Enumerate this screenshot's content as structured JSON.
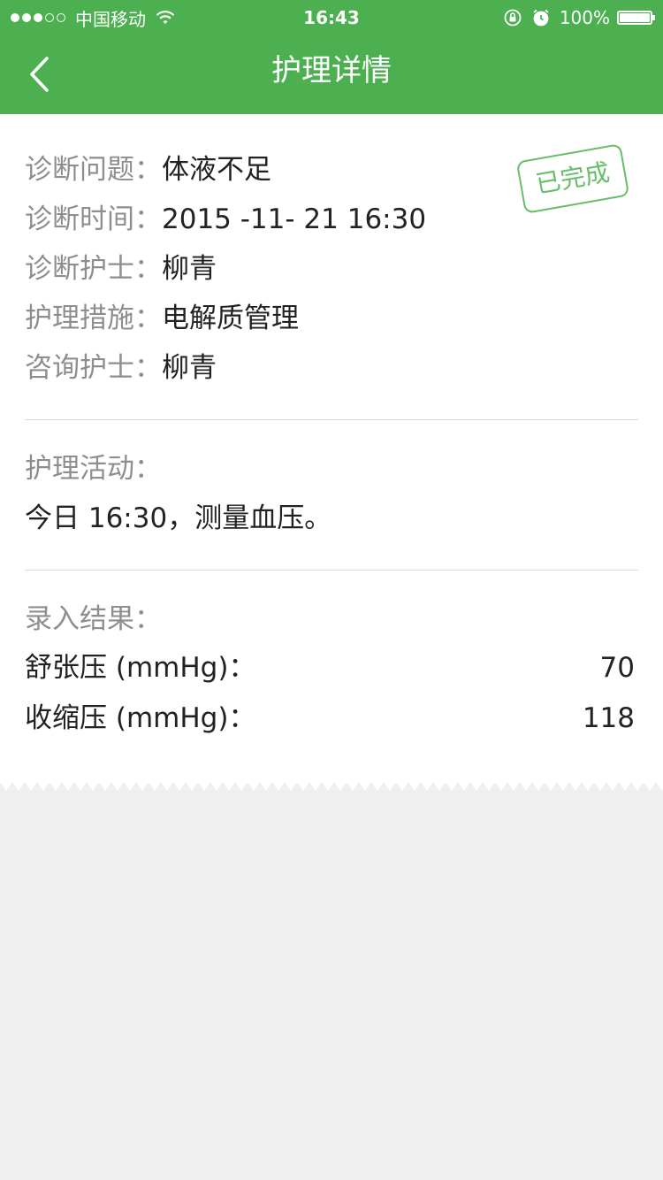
{
  "status_bar": {
    "carrier": "中国移动",
    "time": "16:43",
    "battery_percent": "100%"
  },
  "nav": {
    "title": "护理详情"
  },
  "stamp": {
    "text": "已完成",
    "color": "#5cb85c"
  },
  "diagnosis": [
    {
      "label": "诊断问题：",
      "value": "体液不足"
    },
    {
      "label": "诊断时间：",
      "value": "2015 -11- 21 16:30"
    },
    {
      "label": "诊断护士：",
      "value": "柳青"
    },
    {
      "label": "护理措施：",
      "value": "电解质管理"
    },
    {
      "label": "咨询护士：",
      "value": "柳青"
    }
  ],
  "activity": {
    "title": "护理活动：",
    "text": "今日 16:30，测量血压。"
  },
  "results": {
    "title": "录入结果：",
    "rows": [
      {
        "label": "舒张压 (mmHg)：",
        "value": "70"
      },
      {
        "label": "收缩压 (mmHg)：",
        "value": "118"
      }
    ]
  },
  "colors": {
    "accent": "#4caf50",
    "background": "#efefef",
    "card": "#ffffff",
    "label_text": "#8e8e8e",
    "value_text": "#222222"
  }
}
